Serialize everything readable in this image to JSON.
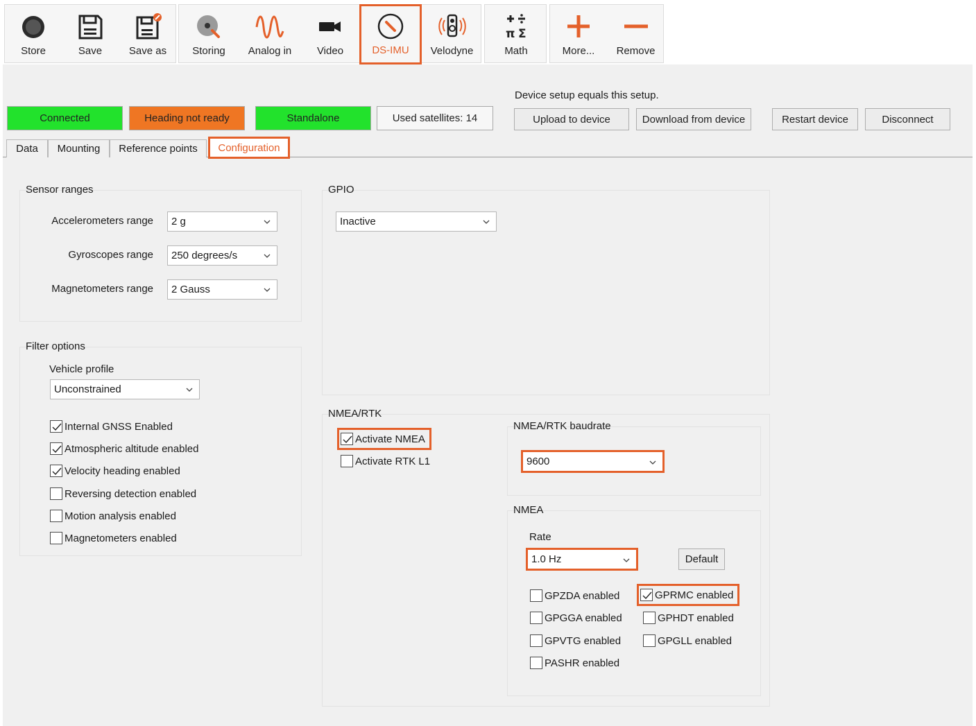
{
  "toolbar": {
    "store": "Store",
    "save": "Save",
    "save_as": "Save as",
    "storing": "Storing",
    "analog_in": "Analog in",
    "video": "Video",
    "ds_imu": "DS-IMU",
    "velodyne": "Velodyne",
    "math": "Math",
    "more": "More...",
    "remove": "Remove"
  },
  "status": {
    "connected": "Connected",
    "heading": "Heading not ready",
    "mode": "Standalone",
    "satellites": "Used satellites: 14"
  },
  "device": {
    "note": "Device setup equals this setup.",
    "upload": "Upload to device",
    "download": "Download from device",
    "restart": "Restart device",
    "disconnect": "Disconnect"
  },
  "tabs": [
    "Data",
    "Mounting",
    "Reference points",
    "Configuration"
  ],
  "sensor_ranges": {
    "title": "Sensor ranges",
    "accel_label": "Accelerometers range",
    "accel_value": "2 g",
    "gyro_label": "Gyroscopes range",
    "gyro_value": "250 degrees/s",
    "mag_label": "Magnetometers range",
    "mag_value": "2 Gauss"
  },
  "filter_options": {
    "title": "Filter options",
    "vehicle_profile_label": "Vehicle profile",
    "vehicle_profile_value": "Unconstrained",
    "checkboxes": [
      {
        "label": "Internal GNSS Enabled",
        "checked": true
      },
      {
        "label": "Atmospheric altitude enabled",
        "checked": true
      },
      {
        "label": "Velocity heading enabled",
        "checked": true
      },
      {
        "label": "Reversing detection enabled",
        "checked": false
      },
      {
        "label": "Motion analysis enabled",
        "checked": false
      },
      {
        "label": "Magnetometers enabled",
        "checked": false
      }
    ]
  },
  "gpio": {
    "title": "GPIO",
    "value": "Inactive"
  },
  "nmea_rtk": {
    "title": "NMEA/RTK",
    "activate_nmea": "Activate NMEA",
    "activate_nmea_checked": true,
    "activate_rtk": "Activate RTK L1",
    "activate_rtk_checked": false,
    "baudrate_title": "NMEA/RTK baudrate",
    "baudrate_value": "9600"
  },
  "nmea": {
    "title": "NMEA",
    "rate_label": "Rate",
    "rate_value": "1.0 Hz",
    "default_button": "Default",
    "left_checkboxes": [
      {
        "label": "GPZDA enabled",
        "checked": false
      },
      {
        "label": "GPGGA enabled",
        "checked": false
      },
      {
        "label": "GPVTG enabled",
        "checked": false
      },
      {
        "label": "PASHR enabled",
        "checked": false
      }
    ],
    "right_checkboxes": [
      {
        "label": "GPRMC enabled",
        "checked": true
      },
      {
        "label": "GPHDT enabled",
        "checked": false
      },
      {
        "label": "GPGLL enabled",
        "checked": false
      }
    ]
  },
  "colors": {
    "accent": "#e4602a",
    "status_green": "#22e22c",
    "status_orange": "#ef7623"
  },
  "icons": {
    "store": "record-circle-icon",
    "save": "floppy-disk-icon",
    "save_as": "floppy-disk-edit-icon",
    "storing": "disk-storage-icon",
    "analog_in": "sine-wave-icon",
    "video": "video-camera-icon",
    "ds_imu": "compass-icon",
    "velodyne": "lidar-speaker-icon",
    "math": "math-operators-icon",
    "more": "plus-icon",
    "remove": "minus-icon"
  }
}
